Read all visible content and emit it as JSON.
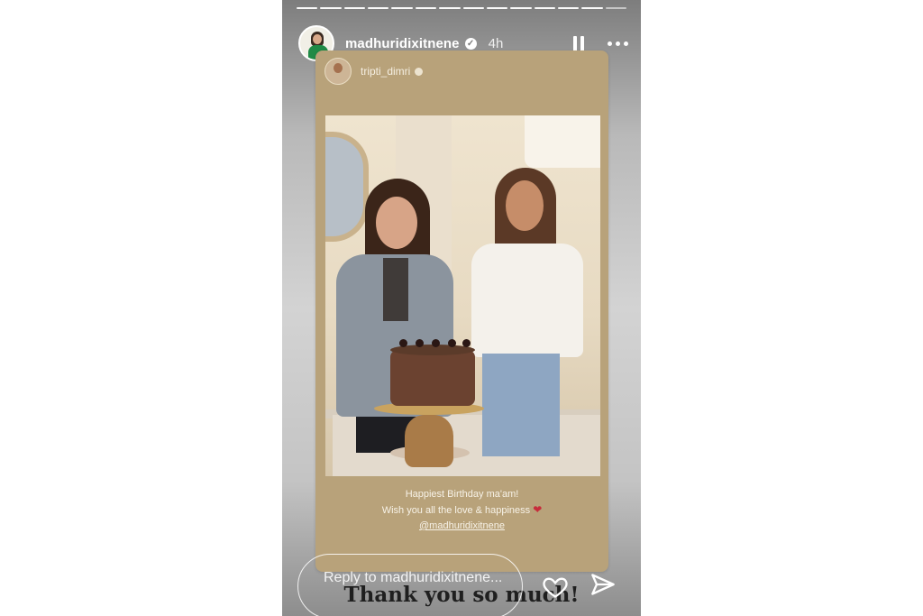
{
  "story": {
    "username": "madhuridixitnene",
    "time": "4h",
    "tag_account": "tripti_dimri",
    "caption_line1": "Happiest Birthday ma'am!",
    "caption_line2": "Wish you all the love & happiness",
    "caption_tag": "@madhuridixitnene",
    "overlay_text": "Thank you so much!",
    "reply_placeholder": "Reply to madhuridixitnene...",
    "progress_segments_total": 14,
    "progress_segments_done": 13
  },
  "icons": {
    "verified": "verified-badge-icon",
    "pause": "pause-icon",
    "more": "more-options-icon",
    "heart": "heart-icon",
    "send": "send-icon"
  },
  "colors": {
    "card_bg": "#b8a27a",
    "heart_red": "#c72c3b"
  }
}
